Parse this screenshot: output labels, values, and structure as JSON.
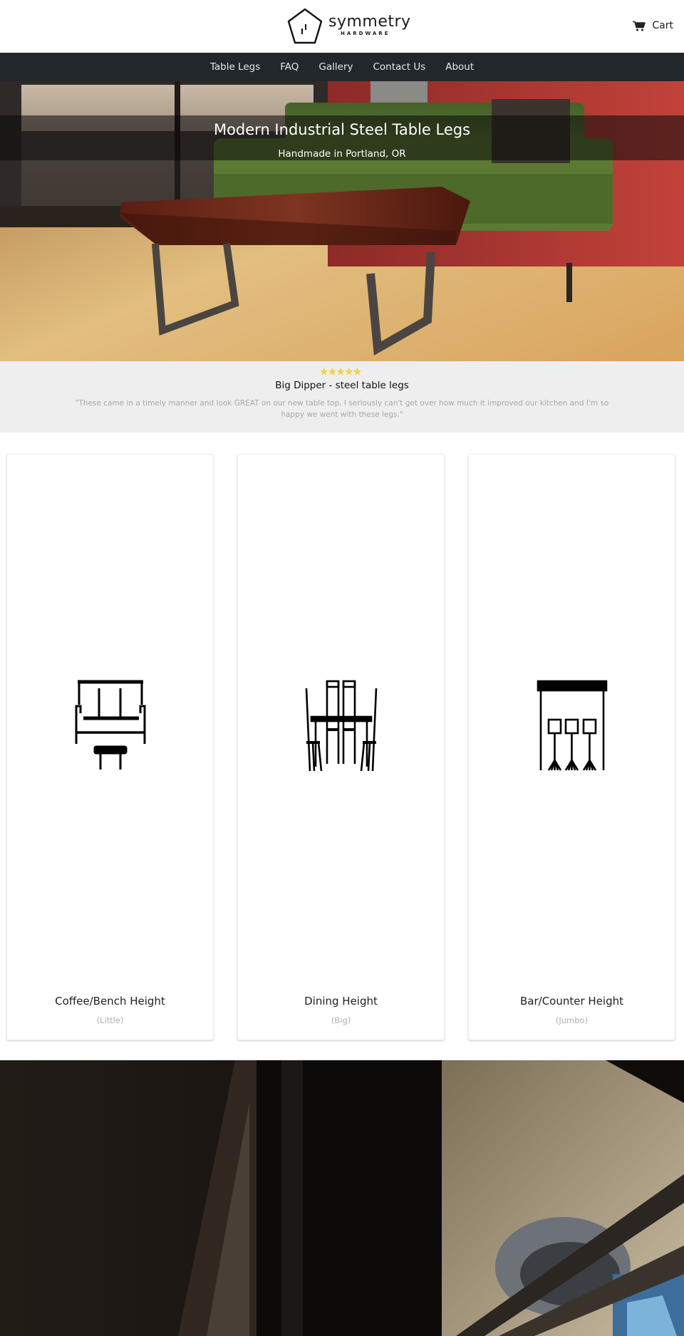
{
  "header": {
    "brand_name": "symmetry",
    "brand_tagline": "HARDWARE",
    "cart_label": "Cart"
  },
  "nav": {
    "items": [
      {
        "label": "Table Legs"
      },
      {
        "label": "FAQ"
      },
      {
        "label": "Gallery"
      },
      {
        "label": "Contact Us"
      },
      {
        "label": "About"
      }
    ]
  },
  "hero": {
    "title": "Modern Industrial Steel Table Legs",
    "subtitle": "Handmade in Portland, OR",
    "image_description": "Wood slab coffee table on steel legs in front of green sofa"
  },
  "review": {
    "rating": 5,
    "rating_max": 5,
    "title": "Big Dipper - steel table legs",
    "quote": "\"These came in a timely manner and look GREAT on our new table top. I seriously can't get over how much it improved our kitchen and I'm so happy we went with these legs.\""
  },
  "categories": [
    {
      "title": "Coffee/Bench Height",
      "size": "(Little)",
      "icon": "sofa-coffee-table-icon"
    },
    {
      "title": "Dining Height",
      "size": "(Big)",
      "icon": "dining-table-chairs-icon"
    },
    {
      "title": "Bar/Counter Height",
      "size": "(Jumbo)",
      "icon": "bar-stools-counter-icon"
    }
  ],
  "workshop": {
    "image_description": "Welder working on steel frame in workshop"
  },
  "colors": {
    "nav_bg": "#22272c",
    "review_bg": "#eeeeee",
    "star": "#f6d33b"
  }
}
